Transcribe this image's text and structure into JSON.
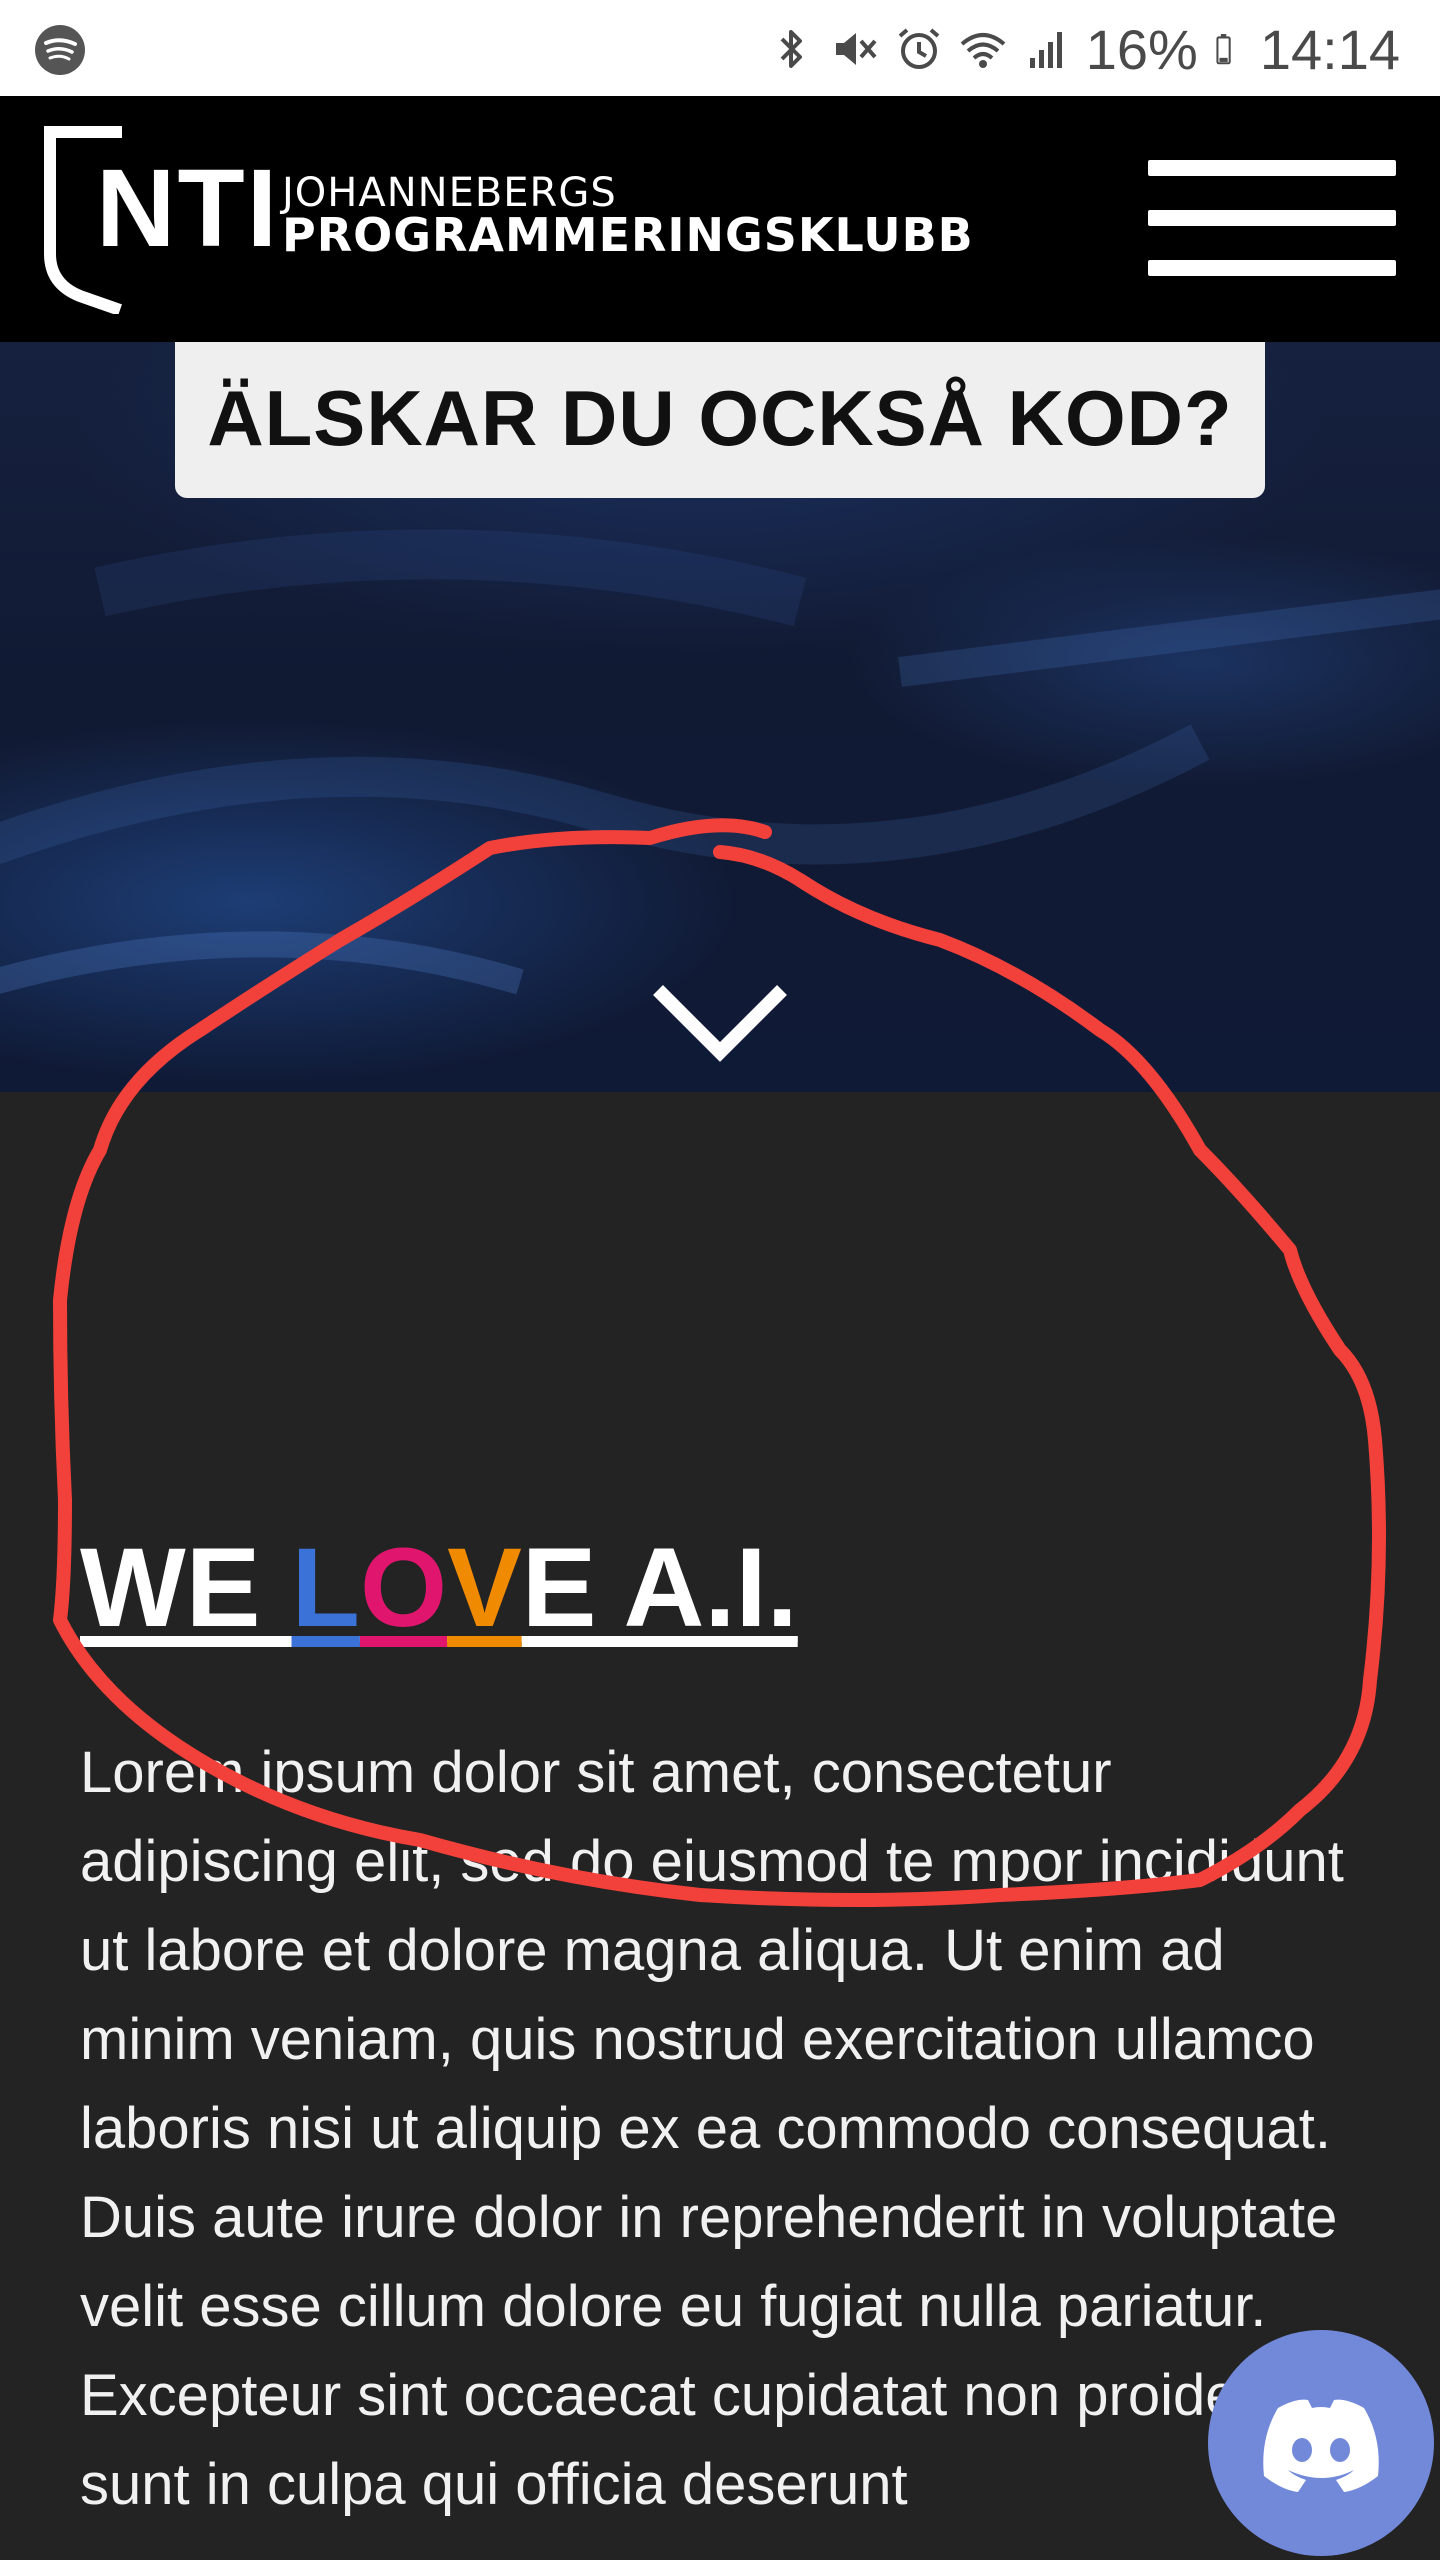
{
  "status_bar": {
    "battery": "16%",
    "time": "14:14",
    "icons": [
      "spotify-icon",
      "bluetooth-icon",
      "mute-icon",
      "alarm-icon",
      "wifi-icon",
      "signal-icon",
      "battery-icon"
    ]
  },
  "navbar": {
    "logo_mark": "NTI",
    "logo_line1": "JOHANNEBERGS",
    "logo_line2": "PROGRAMMERINGSKLUBB",
    "menu_icon": "hamburger-menu-icon"
  },
  "hero": {
    "button_label": "ÄLSKAR DU OCKSÅ KOD?",
    "scroll_icon": "chevron-down-icon"
  },
  "section": {
    "heading": {
      "part1": "WE ",
      "l": "L",
      "o": "O",
      "v": "V",
      "part2": "E A.I."
    },
    "body": "Lorem ipsum dolor sit amet, consectetur adipiscing elit, sed do eiusmod te mpor incididunt ut labore et dolore magna aliqua. Ut enim ad minim veniam, quis nostrud exercitation ullamco laboris nisi ut aliquip ex ea commodo consequat. Duis aute irure dolor in reprehenderit in voluptate velit esse cillum dolore eu fugiat nulla pariatur. Excepteur sint occaecat cupidatat non proident, sunt in culpa qui officia deserunt"
  },
  "floating": {
    "discord_icon": "discord-icon"
  },
  "colors": {
    "heading_l": "#3a72d8",
    "heading_o": "#e0156e",
    "heading_v": "#f08a00",
    "annotation": "#f2403a",
    "discord": "#7289da"
  }
}
